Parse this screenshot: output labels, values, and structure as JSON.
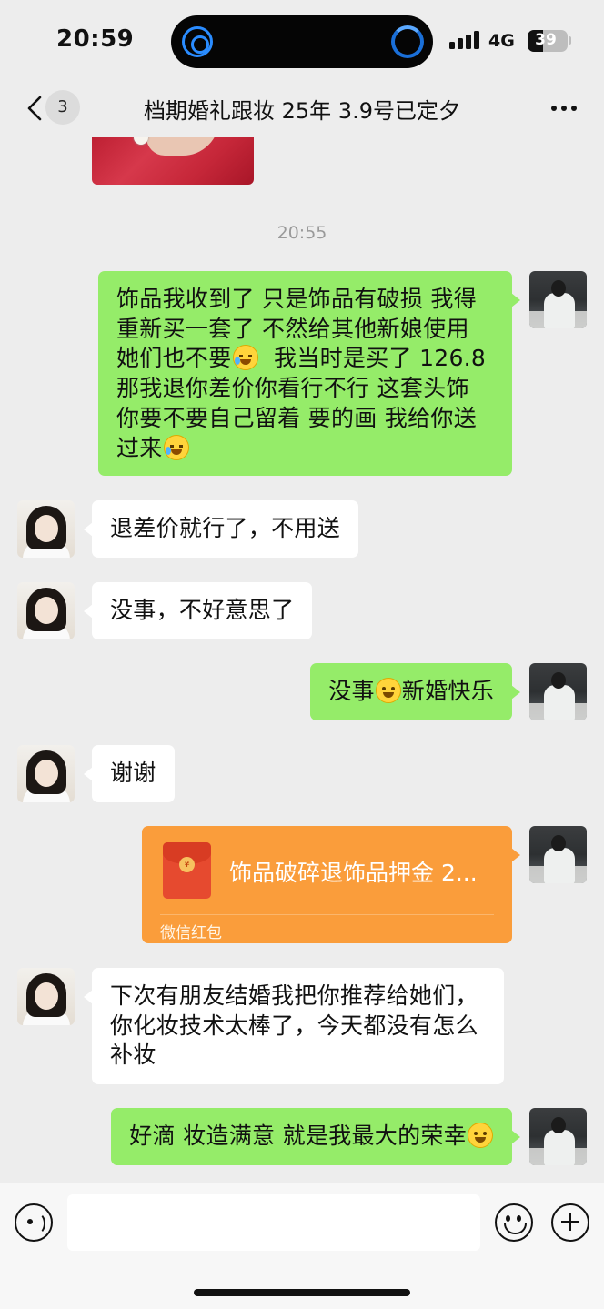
{
  "status_bar": {
    "time": "20:59",
    "network": "4G",
    "battery": "39",
    "battery_level": 0.39
  },
  "nav": {
    "unread_count": "3",
    "title": "档期婚礼跟妆 25年 3.9号已定夕"
  },
  "chat": {
    "timestamp": "20:55",
    "messages": [
      {
        "from": "self",
        "lines": [
          "饰品我收到了  只是饰品有破损 我得",
          "重新买一套了  不然给其他新娘使用",
          "她们也不要",
          "我当时是买了 126.8",
          "那我退你差价你看行不行  这套头饰",
          "你要不要自己留着  要的画 我给你送",
          "过来"
        ]
      },
      {
        "from": "other",
        "text": "退差价就行了，不用送"
      },
      {
        "from": "other",
        "text": "没事，不好意思了"
      },
      {
        "from": "self",
        "text_before": "没事",
        "text_after": "新婚快乐"
      },
      {
        "from": "other",
        "text": "谢谢"
      },
      {
        "from": "self",
        "type": "red-packet",
        "title": "饰品破碎退饰品押金 2...",
        "footer": "微信红包"
      },
      {
        "from": "other",
        "lines": [
          "下次有朋友结婚我把你推荐给她们，",
          "你化妆技术太棒了，今天都没有怎么",
          "补妆"
        ]
      },
      {
        "from": "self",
        "text": "好滴  妆造满意  就是我最大的荣幸"
      }
    ]
  },
  "icons": {
    "back": "chevron-left-icon",
    "more": "more-dots-icon",
    "voice": "voice-icon",
    "emoji": "emoji-icon",
    "plus": "plus-icon"
  }
}
